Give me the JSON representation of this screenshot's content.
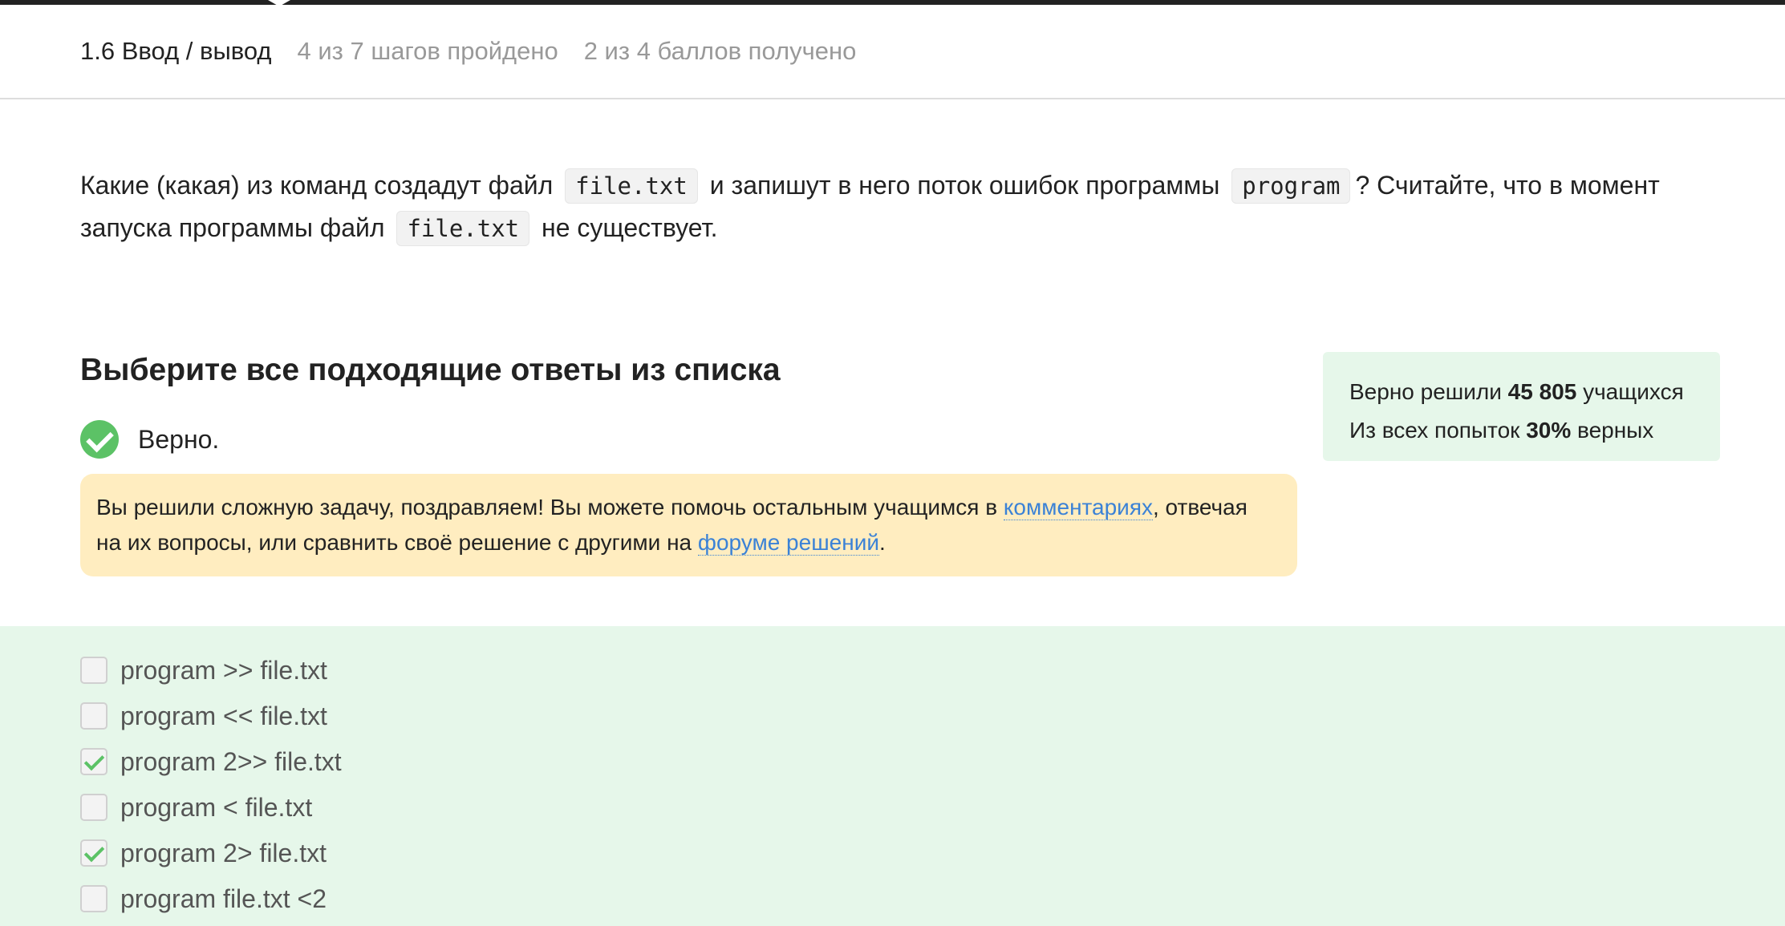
{
  "header": {
    "lesson_title": "1.6 Ввод / вывод",
    "steps_progress": "4 из 7 шагов пройдено",
    "points_progress": "2 из 4 баллов  получено"
  },
  "question": {
    "part1": "Какие (какая) из команд создадут файл",
    "code1": "file.txt",
    "part2": "и запишут в него поток ошибок программы",
    "code2": "program",
    "part3": "? Считайте, что в момент",
    "part4": "запуска программы файл",
    "code3": "file.txt",
    "part5": "не существует."
  },
  "answers": {
    "title": "Выберите все подходящие ответы из списка",
    "verdict": "Верно."
  },
  "congrats": {
    "text1": "Вы решили сложную задачу, поздравляем! Вы можете помочь остальным учащимся в",
    "comments_link": "комментариях",
    "text2": ", отвечая",
    "text3": "на их вопросы, или сравнить своё решение с другими на",
    "forum_link": "форуме решений",
    "text4": "."
  },
  "stats": {
    "solved_prefix": "Верно решили",
    "solved_count": "45 805",
    "solved_suffix": "учащихся",
    "attempts_prefix": "Из всех попыток",
    "attempts_percent": "30%",
    "attempts_suffix": "верных"
  },
  "options": [
    {
      "label": "program >> file.txt",
      "checked": false
    },
    {
      "label": "program << file.txt",
      "checked": false
    },
    {
      "label": "program 2>> file.txt",
      "checked": true
    },
    {
      "label": "program < file.txt",
      "checked": false
    },
    {
      "label": "program 2> file.txt",
      "checked": true
    },
    {
      "label": "program file.txt <2",
      "checked": false
    }
  ],
  "colors": {
    "success_green": "#5cc266",
    "options_background": "#e6f7ea",
    "congrats_background": "#ffedc0",
    "link_blue": "#3b82d6"
  }
}
